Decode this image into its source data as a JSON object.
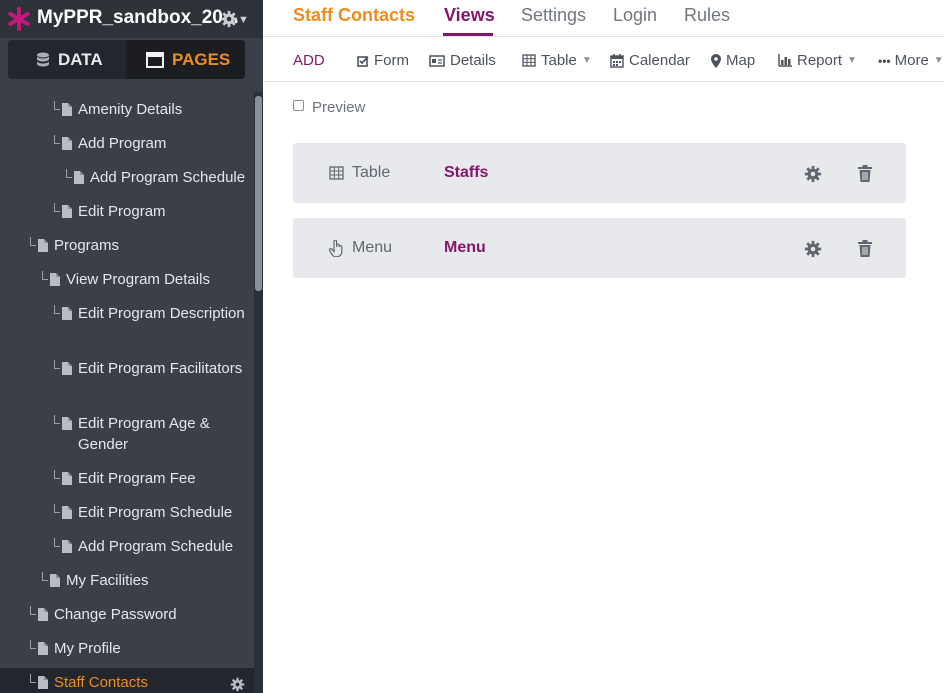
{
  "app": {
    "title": "MyPPR_sandbox_20..."
  },
  "sidebar": {
    "tabs": [
      {
        "label": "DATA"
      },
      {
        "label": "PAGES"
      }
    ],
    "tree": [
      {
        "label": "Amenity Details",
        "depth": 2
      },
      {
        "label": "Add Program",
        "depth": 2
      },
      {
        "label": "Add Program Schedule",
        "depth": 3
      },
      {
        "label": "Edit Program",
        "depth": 2
      },
      {
        "label": "Programs",
        "depth": 0
      },
      {
        "label": "View Program Details",
        "depth": 1
      },
      {
        "label": "Edit Program Description",
        "depth": 2
      },
      {
        "label": "Edit Program Facilitators",
        "depth": 2
      },
      {
        "label": "Edit Program Age & Gender",
        "depth": 2
      },
      {
        "label": "Edit Program Fee",
        "depth": 2
      },
      {
        "label": "Edit Program Schedule",
        "depth": 2
      },
      {
        "label": "Add Program Schedule",
        "depth": 2
      },
      {
        "label": "My Facilities",
        "depth": 1
      },
      {
        "label": "Change Password",
        "depth": 0
      },
      {
        "label": "My Profile",
        "depth": 0
      },
      {
        "label": "Staff Contacts",
        "depth": 0,
        "selected": true
      }
    ]
  },
  "topnav": {
    "object_title": "Staff Contacts",
    "tabs": [
      "Views",
      "Settings",
      "Login",
      "Rules"
    ],
    "active_tab": "Views"
  },
  "toolbar": {
    "add": "ADD",
    "form": "Form",
    "details": "Details",
    "table": "Table",
    "calendar": "Calendar",
    "map": "Map",
    "report": "Report",
    "more": "More"
  },
  "content": {
    "preview_label": "Preview",
    "preview_checked": false,
    "views": [
      {
        "type": "Table",
        "type_icon": "table-icon",
        "name": "Staffs"
      },
      {
        "type": "Menu",
        "type_icon": "pointer-hand-icon",
        "name": "Menu"
      }
    ]
  },
  "colors": {
    "brand": "#86166d",
    "accent_orange": "#f08c1e",
    "sidebar_bg": "#3a3f48"
  }
}
